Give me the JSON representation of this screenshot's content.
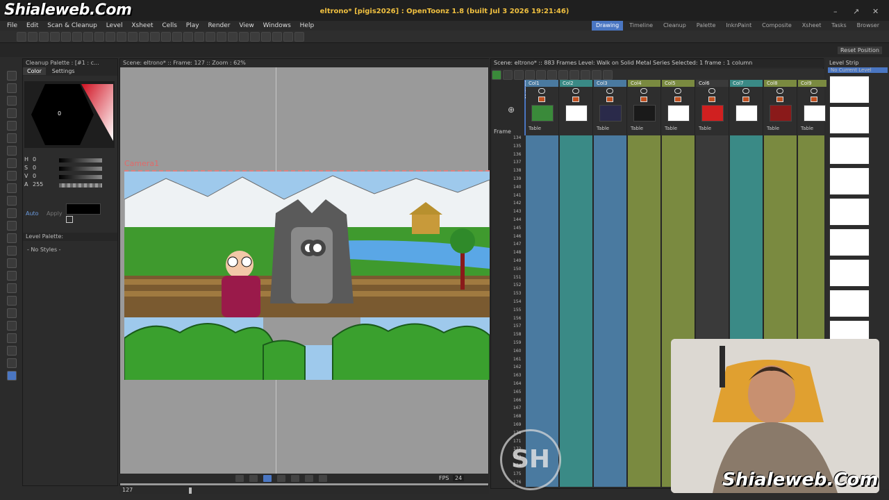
{
  "branding": {
    "logo": "Shialeweb.Com",
    "watermark": "Shialeweb.Com",
    "sh_logo": "SH"
  },
  "window": {
    "title": "eltrono* [pigis2026] : OpenToonz 1.8 (built Jul 3 2026 19:21:46)",
    "minimize": "–",
    "maximize": "↗",
    "close": "✕"
  },
  "menu": [
    "File",
    "Edit",
    "Scan & Cleanup",
    "Level",
    "Xsheet",
    "Cells",
    "Play",
    "Render",
    "View",
    "Windows",
    "Help"
  ],
  "rooms": [
    {
      "label": "Drawing",
      "active": true
    },
    {
      "label": "Timeline"
    },
    {
      "label": "Cleanup"
    },
    {
      "label": "Palette"
    },
    {
      "label": "InknPaint"
    },
    {
      "label": "Composite"
    },
    {
      "label": "Xsheet"
    },
    {
      "label": "Tasks"
    },
    {
      "label": "Browser"
    }
  ],
  "reset_position": "Reset Position",
  "cleanup_palette": {
    "title": "Cleanup Palette : [#1 : c...",
    "tabs": [
      "Color",
      "Settings"
    ],
    "hex_label": "0",
    "channels": [
      {
        "label": "H",
        "value": "0"
      },
      {
        "label": "S",
        "value": "0"
      },
      {
        "label": "V",
        "value": "0"
      },
      {
        "label": "A",
        "value": "255"
      }
    ],
    "auto": "Auto",
    "apply": "Apply"
  },
  "level_palette": {
    "title": "Level Palette:",
    "empty": "- No Styles -"
  },
  "viewer": {
    "header": "Scene: eltrono*  ::  Frame: 127  ::  Zoom : 62%",
    "camera": "Camera1"
  },
  "playback": {
    "fps_label": "FPS",
    "fps": "24",
    "frame": "127"
  },
  "xsheet": {
    "header": "Scene: eltrono*  ::  883 Frames  Level: Walk on Solid Metal Series  Selected: 1 frame : 1 column",
    "frame_label": "Frame",
    "camera_col": "Camera1",
    "columns": [
      {
        "name": "Col1",
        "table": "Table",
        "color": "#4a7aa0"
      },
      {
        "name": "Col2",
        "table": "",
        "color": "#3a8a86"
      },
      {
        "name": "Col3",
        "table": "Table",
        "color": "#4a7aa0"
      },
      {
        "name": "Col4",
        "table": "Table",
        "color": "#7a8a40"
      },
      {
        "name": "Col5",
        "table": "Table",
        "color": "#7a8a40"
      },
      {
        "name": "Col6",
        "table": "Table",
        "color": "#3a3a3a"
      },
      {
        "name": "Col7",
        "table": "",
        "color": "#3a8a86"
      },
      {
        "name": "Col8",
        "table": "Table",
        "color": "#7a8a40"
      },
      {
        "name": "Col9",
        "table": "Table",
        "color": "#7a8a40"
      }
    ],
    "frame_numbers": [
      "134",
      "135",
      "136",
      "137",
      "138",
      "139",
      "140",
      "141",
      "142",
      "143",
      "144",
      "145",
      "146",
      "147",
      "148",
      "149",
      "150",
      "151",
      "152",
      "153",
      "154",
      "155",
      "156",
      "157",
      "158",
      "159",
      "160",
      "161",
      "162",
      "163",
      "164",
      "165",
      "166",
      "167",
      "168",
      "169",
      "170",
      "171",
      "172",
      "173",
      "174",
      "175",
      "176"
    ]
  },
  "level_strip": {
    "title": "Level Strip",
    "current": "No Current Level"
  }
}
